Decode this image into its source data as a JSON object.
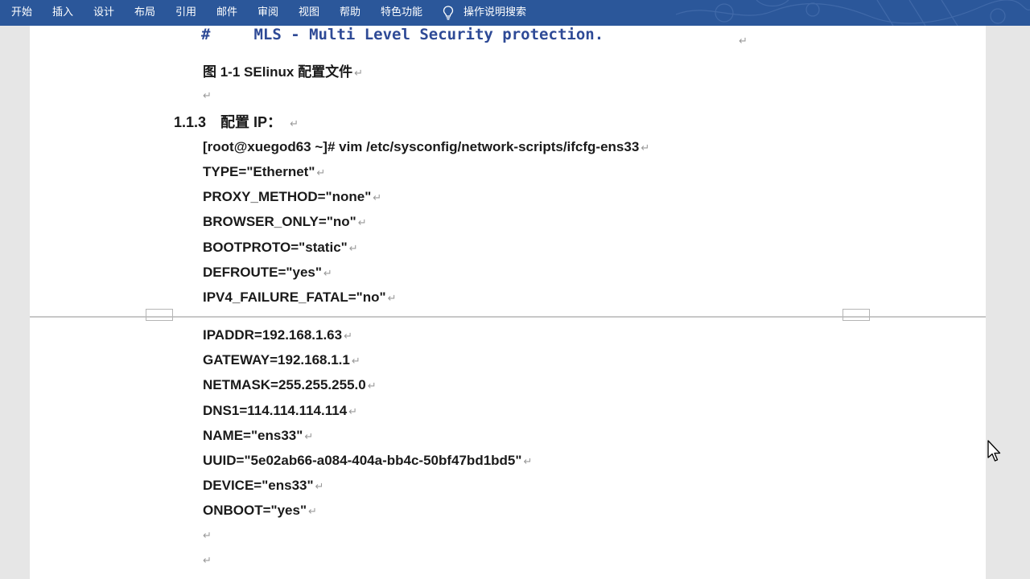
{
  "ribbon": {
    "tabs": [
      "开始",
      "插入",
      "设计",
      "布局",
      "引用",
      "邮件",
      "审阅",
      "视图",
      "帮助",
      "特色功能"
    ],
    "search_label": "操作说明搜索",
    "bg_color": "#2b579a",
    "search_icon": "lightbulb-icon"
  },
  "document": {
    "mls_hash": "#",
    "mls_line": "MLS - Multi Level Security protection.",
    "figure_caption": "图 1-1 SElinux 配置文件",
    "heading_number": "1.1.3",
    "heading_text": "配置 IP：",
    "command": "[root@xuegod63 ~]# vim /etc/sysconfig/network-scripts/ifcfg-ens33",
    "config_lines_page1": [
      "TYPE=\"Ethernet\"",
      "PROXY_METHOD=\"none\"",
      "BROWSER_ONLY=\"no\"",
      "BOOTPROTO=\"static\"",
      "DEFROUTE=\"yes\"",
      "IPV4_FAILURE_FATAL=\"no\""
    ],
    "config_lines_page2": [
      "IPADDR=192.168.1.63",
      "GATEWAY=192.168.1.1",
      "NETMASK=255.255.255.0",
      "DNS1=114.114.114.114",
      "NAME=\"ens33\"",
      "UUID=\"5e02ab66-a084-404a-bb4c-50bf47bd1bd5\"",
      "DEVICE=\"ens33\"",
      "ONBOOT=\"yes\""
    ],
    "paragraph_mark": "↵"
  }
}
